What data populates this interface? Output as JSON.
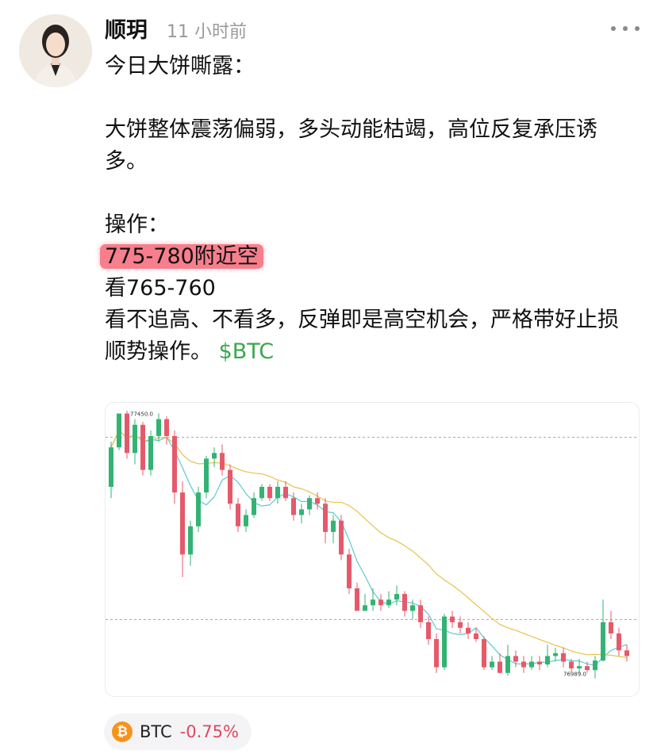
{
  "post": {
    "author": "顺玥",
    "time": "11 小时前",
    "lines": {
      "l1": "今日大饼嘶露：",
      "l2": "大饼整体震荡偏弱，多头动能枯竭，高位反复承压诱多。",
      "l3": "操作：",
      "l4": "775-780附近空",
      "l5": "看765-760",
      "l6": "看不追高、不看多，反弹即是高空机会，严格带好止损顺势操作。",
      "cashtag": "$BTC"
    }
  },
  "chart_data": {
    "type": "candlestick",
    "high_label": "77450.0",
    "low_label": "76989.0",
    "candles": [
      [
        77320,
        77390,
        77300,
        77400
      ],
      [
        77390,
        77450,
        77385,
        77450
      ],
      [
        77450,
        77380,
        77370,
        77455
      ],
      [
        77380,
        77430,
        77360,
        77440
      ],
      [
        77430,
        77350,
        77340,
        77435
      ],
      [
        77350,
        77410,
        77340,
        77420
      ],
      [
        77410,
        77440,
        77400,
        77450
      ],
      [
        77440,
        77410,
        77395,
        77445
      ],
      [
        77410,
        77310,
        77290,
        77420
      ],
      [
        77310,
        77200,
        77160,
        77330
      ],
      [
        77200,
        77250,
        77180,
        77260
      ],
      [
        77250,
        77310,
        77240,
        77320
      ],
      [
        77310,
        77370,
        77300,
        77375
      ],
      [
        77370,
        77380,
        77355,
        77390
      ],
      [
        77380,
        77350,
        77340,
        77395
      ],
      [
        77350,
        77290,
        77280,
        77360
      ],
      [
        77290,
        77250,
        77240,
        77300
      ],
      [
        77250,
        77270,
        77240,
        77280
      ],
      [
        77270,
        77300,
        77265,
        77310
      ],
      [
        77300,
        77320,
        77295,
        77325
      ],
      [
        77320,
        77300,
        77295,
        77325
      ],
      [
        77300,
        77320,
        77290,
        77330
      ],
      [
        77320,
        77300,
        77295,
        77330
      ],
      [
        77300,
        77270,
        77260,
        77310
      ],
      [
        77270,
        77280,
        77255,
        77290
      ],
      [
        77280,
        77300,
        77270,
        77305
      ],
      [
        77300,
        77290,
        77280,
        77310
      ],
      [
        77290,
        77240,
        77220,
        77300
      ],
      [
        77240,
        77260,
        77220,
        77270
      ],
      [
        77260,
        77200,
        77190,
        77270
      ],
      [
        77200,
        77140,
        77130,
        77210
      ],
      [
        77140,
        77100,
        77100,
        77150
      ],
      [
        77100,
        77110,
        77100,
        77130
      ],
      [
        77110,
        77120,
        77100,
        77140
      ],
      [
        77120,
        77110,
        77100,
        77130
      ],
      [
        77110,
        77120,
        77105,
        77135
      ],
      [
        77120,
        77130,
        77110,
        77145
      ],
      [
        77130,
        77100,
        77090,
        77135
      ],
      [
        77100,
        77110,
        77085,
        77120
      ],
      [
        77110,
        77080,
        77070,
        77120
      ],
      [
        77080,
        77050,
        77040,
        77090
      ],
      [
        77050,
        77000,
        76990,
        77060
      ],
      [
        77000,
        77090,
        76995,
        77095
      ],
      [
        77090,
        77080,
        77070,
        77100
      ],
      [
        77080,
        77070,
        77060,
        77090
      ],
      [
        77070,
        77060,
        77050,
        77080
      ],
      [
        77060,
        77050,
        77045,
        77070
      ],
      [
        77050,
        77000,
        76995,
        77055
      ],
      [
        77000,
        77010,
        76995,
        77020
      ],
      [
        77010,
        76990,
        76989,
        77025
      ],
      [
        76990,
        77020,
        76985,
        77040
      ],
      [
        77020,
        77010,
        77000,
        77030
      ],
      [
        77010,
        77000,
        76990,
        77020
      ],
      [
        77000,
        77010,
        76995,
        77020
      ],
      [
        77010,
        77005,
        76995,
        77020
      ],
      [
        77005,
        77020,
        77000,
        77040
      ],
      [
        77020,
        77025,
        77010,
        77035
      ],
      [
        77025,
        77010,
        77000,
        77035
      ],
      [
        77010,
        76998,
        76992,
        77015
      ],
      [
        76998,
        77002,
        76990,
        77015
      ],
      [
        77002,
        76995,
        76990,
        77010
      ],
      [
        76995,
        77012,
        76980,
        77020
      ],
      [
        77012,
        77080,
        77010,
        77120
      ],
      [
        77080,
        77060,
        77050,
        77100
      ],
      [
        77060,
        77030,
        77020,
        77070
      ],
      [
        77030,
        77020,
        77010,
        77040
      ]
    ],
    "grid": false
  },
  "ticker": {
    "symbol": "BTC",
    "change": "-0.75%",
    "coin_glyph": "₿",
    "coin_color": "#f7931a"
  }
}
